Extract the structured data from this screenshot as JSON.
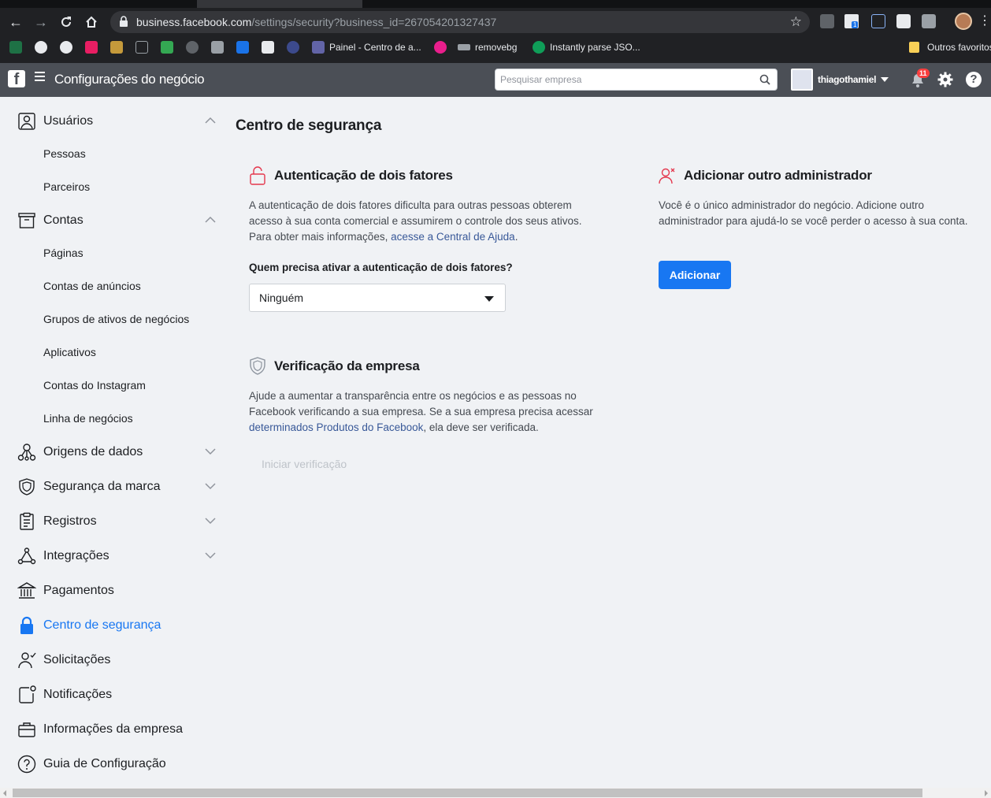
{
  "browser": {
    "url_host": "business.facebook.com",
    "url_path": "/settings/security?business_id=267054201327437",
    "bookmarks": [
      {
        "label": "Painel - Centro de a..."
      },
      {
        "label": "removebg"
      },
      {
        "label": "Instantly parse JSO..."
      }
    ],
    "other_bookmarks": "Outros favoritos",
    "ext_badge": "1"
  },
  "header": {
    "logo": "f",
    "title": "Configurações do negócio",
    "search_placeholder": "Pesquisar empresa",
    "account_name": "thiagothamiel",
    "notification_count": "11",
    "help_glyph": "?"
  },
  "sidebar": {
    "usuarios": "Usuários",
    "pessoas": "Pessoas",
    "parceiros": "Parceiros",
    "contas": "Contas",
    "paginas": "Páginas",
    "contas_anuncios": "Contas de anúncios",
    "grupos_ativos": "Grupos de ativos de negócios",
    "aplicativos": "Aplicativos",
    "contas_instagram": "Contas do Instagram",
    "linha_negocios": "Linha de negócios",
    "origens_dados": "Origens de dados",
    "seguranca_marca": "Segurança da marca",
    "registros": "Registros",
    "integracoes": "Integrações",
    "pagamentos": "Pagamentos",
    "centro_seguranca": "Centro de segurança",
    "solicitacoes": "Solicitações",
    "notificacoes": "Notificações",
    "informacoes_empresa": "Informações da empresa",
    "guia_configuracao": "Guia de Configuração"
  },
  "main": {
    "page_title": "Centro de segurança",
    "two_factor": {
      "heading": "Autenticação de dois fatores",
      "text_1": "A autenticação de dois fatores dificulta para outras pessoas obterem acesso à sua conta comercial e assumirem o controle dos seus ativos. Para obter mais informações, ",
      "link": "acesse a Central de Ajuda",
      "text_2": ".",
      "question": "Quem precisa ativar a autenticação de dois fatores?",
      "selected": "Ninguém"
    },
    "verification": {
      "heading": "Verificação da empresa",
      "text_1": "Ajude a aumentar a transparência entre os negócios e as pessoas no Facebook verificando a sua empresa. Se a sua empresa precisa acessar ",
      "link": "determinados Produtos do Facebook",
      "text_2": ", ela deve ser verificada.",
      "button": "Iniciar verificação"
    },
    "admin": {
      "heading": "Adicionar outro administrador",
      "text": "Você é o único administrador do negócio. Adicione outro administrador para ajudá-lo se você perder o acesso à sua conta.",
      "button": "Adicionar"
    }
  },
  "colors": {
    "accent": "#1877f2",
    "header_bg": "#4b4f56",
    "page_bg": "#f0f2f5",
    "danger_icon": "#e4374d"
  }
}
